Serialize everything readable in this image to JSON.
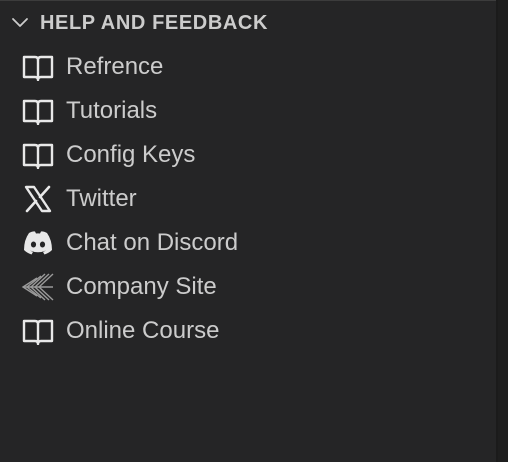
{
  "section": {
    "title": "HELP AND FEEDBACK",
    "expanded": true,
    "toggle_icon": "chevron-down-icon"
  },
  "items": [
    {
      "label": "Refrence",
      "icon": "book-icon"
    },
    {
      "label": "Tutorials",
      "icon": "book-icon"
    },
    {
      "label": "Config Keys",
      "icon": "book-icon"
    },
    {
      "label": "Twitter",
      "icon": "x-logo-icon"
    },
    {
      "label": "Chat on Discord",
      "icon": "discord-icon"
    },
    {
      "label": "Company Site",
      "icon": "company-logo-icon"
    },
    {
      "label": "Online Course",
      "icon": "book-icon"
    }
  ],
  "colors": {
    "panel_background": "#252526",
    "text": "#cccccc",
    "icon": "#e8e8e8"
  }
}
